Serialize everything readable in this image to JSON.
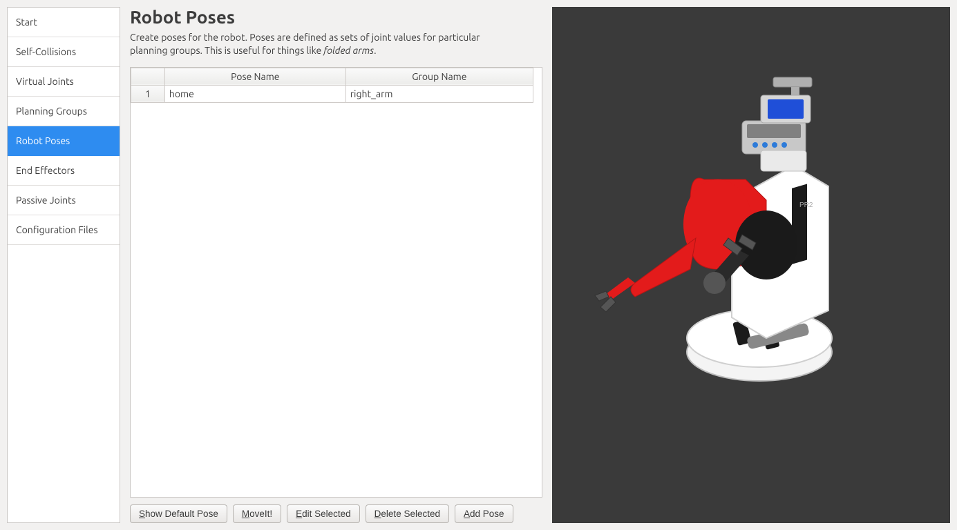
{
  "sidebar": {
    "items": [
      {
        "label": "Start",
        "active": false
      },
      {
        "label": "Self-Collisions",
        "active": false
      },
      {
        "label": "Virtual Joints",
        "active": false
      },
      {
        "label": "Planning Groups",
        "active": false
      },
      {
        "label": "Robot Poses",
        "active": true
      },
      {
        "label": "End Effectors",
        "active": false
      },
      {
        "label": "Passive Joints",
        "active": false
      },
      {
        "label": "Configuration Files",
        "active": false
      }
    ]
  },
  "page": {
    "title": "Robot Poses",
    "description_pre": "Create poses for the robot. Poses are defined as sets of joint values for particular planning groups. This is useful for things like ",
    "description_em": "folded arms",
    "description_post": "."
  },
  "table": {
    "headers": {
      "pose": "Pose Name",
      "group": "Group Name"
    },
    "rows": [
      {
        "n": "1",
        "pose": "home",
        "group": "right_arm"
      }
    ]
  },
  "buttons": {
    "show_default": {
      "pre": "",
      "ul": "S",
      "post": "how Default Pose"
    },
    "moveit": {
      "pre": "",
      "ul": "M",
      "post": "oveIt!"
    },
    "edit": {
      "pre": "",
      "ul": "E",
      "post": "dit Selected"
    },
    "delete": {
      "pre": "",
      "ul": "D",
      "post": "elete Selected"
    },
    "add": {
      "pre": "",
      "ul": "A",
      "post": "dd Pose"
    }
  },
  "viewer": {
    "bg": "#3a3a3a",
    "robot_name": "PR2",
    "scene_label": "robot-3d-view"
  }
}
